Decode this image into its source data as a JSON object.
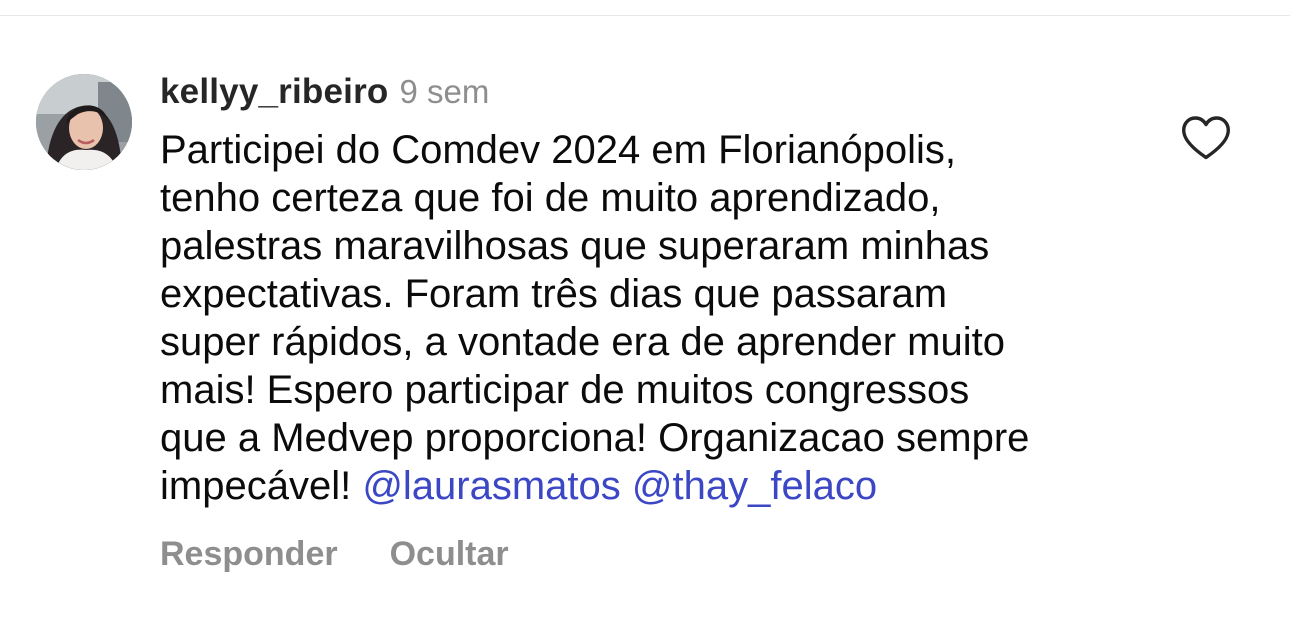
{
  "comment": {
    "username": "kellyy_ribeiro",
    "timestamp": "9 sem",
    "text_lines": [
      "Participei do Comdev 2024 em Florianópolis,",
      "tenho certeza que foi de muito aprendizado,",
      "palestras maravilhosas que superaram minhas",
      "expectativas. Foram três dias que passaram",
      "super rápidos, a vontade era de aprender muito",
      "mais! Espero participar de muitos congressos",
      "que a Medvep proporciona! Organizacao sempre",
      "impecável! "
    ],
    "mentions": [
      "@laurasmatos",
      "@thay_felaco"
    ],
    "actions": {
      "reply": "Responder",
      "hide": "Ocultar"
    },
    "like_icon": "heart-outline-icon",
    "avatar_icon": "user-avatar"
  },
  "colors": {
    "username": "#262626",
    "meta": "#8e8e8e",
    "mention": "#3b47c4",
    "divider": "#e6e6e6"
  }
}
